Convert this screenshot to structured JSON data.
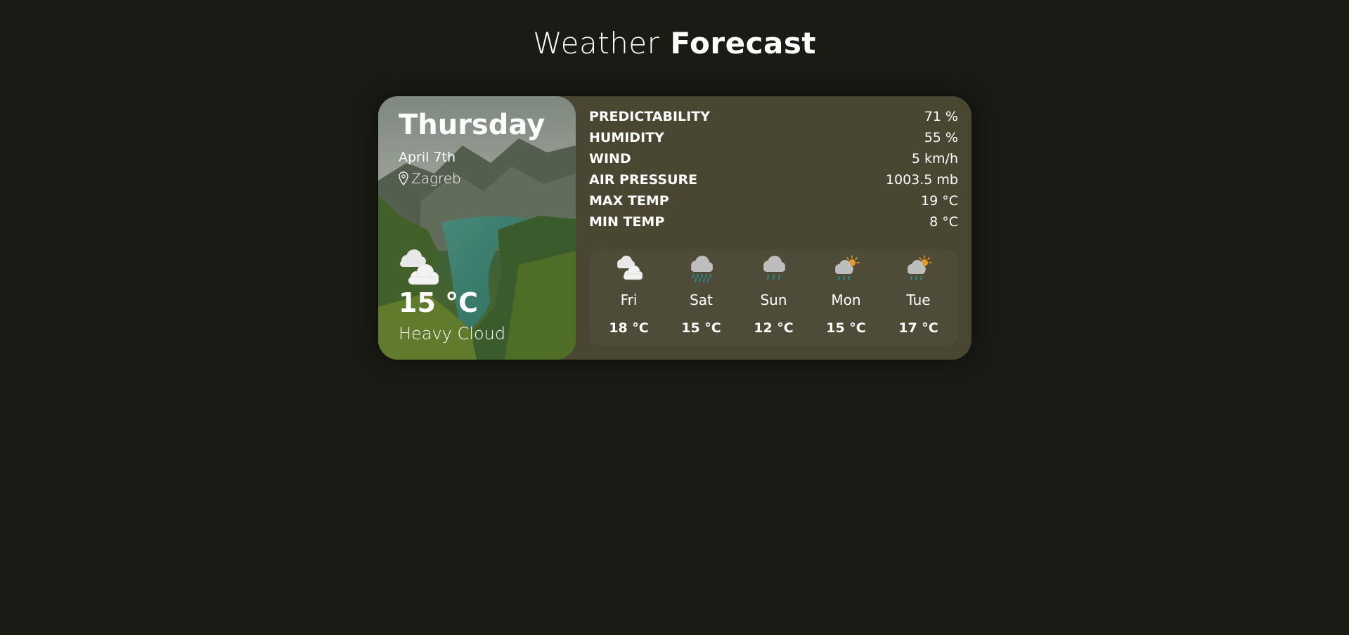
{
  "page": {
    "title_light": "Weather",
    "title_bold": "Forecast"
  },
  "current": {
    "day": "Thursday",
    "date": "April 7th",
    "location": "Zagreb",
    "location_icon": "map-pin-icon",
    "icon": "heavy-cloud-icon",
    "temperature": "15 °C",
    "description": "Heavy Cloud"
  },
  "stats": [
    {
      "label": "PREDICTABILITY",
      "value": "71 %"
    },
    {
      "label": "HUMIDITY",
      "value": "55 %"
    },
    {
      "label": "WIND",
      "value": "5 km/h"
    },
    {
      "label": "AIR PRESSURE",
      "value": "1003.5 mb"
    },
    {
      "label": "MAX TEMP",
      "value": "19 °C"
    },
    {
      "label": "MIN TEMP",
      "value": "8 °C"
    }
  ],
  "forecast": [
    {
      "day": "Fri",
      "temp": "18 °C",
      "icon": "heavy-cloud-icon"
    },
    {
      "day": "Sat",
      "temp": "15 °C",
      "icon": "heavy-rain-icon"
    },
    {
      "day": "Sun",
      "temp": "12 °C",
      "icon": "light-rain-icon"
    },
    {
      "day": "Mon",
      "temp": "15 °C",
      "icon": "showers-icon"
    },
    {
      "day": "Tue",
      "temp": "17 °C",
      "icon": "showers-icon"
    }
  ],
  "colors": {
    "background": "#1a1b15",
    "card": "#494632",
    "forecast_panel": "#4e4b38",
    "text": "#ffffff",
    "rain": "#2f8a8a",
    "sun": "#e69a2a"
  }
}
